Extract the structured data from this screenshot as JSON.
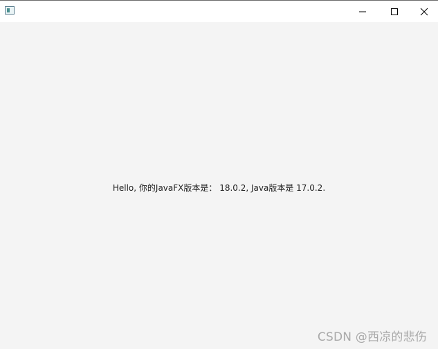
{
  "window": {
    "title": "",
    "icon": "app-window-icon",
    "controls": {
      "minimize": "minimize-icon",
      "maximize": "maximize-icon",
      "close": "close-icon"
    }
  },
  "content": {
    "message": "Hello, 你的JavaFX版本是： 18.0.2, Java版本是 17.0.2."
  },
  "watermark": {
    "text": "CSDN @西凉的悲伤"
  },
  "colors": {
    "titlebar": "#ffffff",
    "background": "#f4f4f4",
    "text": "#1e1e1e",
    "watermark": "#a9a9a9"
  }
}
